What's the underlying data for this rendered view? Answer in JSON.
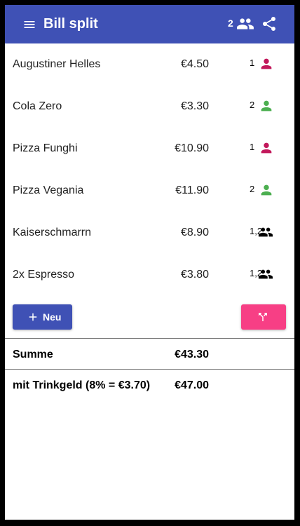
{
  "appbar": {
    "title": "Bill split",
    "people_count": "2",
    "menu_icon": "menu-icon",
    "people_icon": "people-icon",
    "share_icon": "share-icon"
  },
  "items": [
    {
      "name": "Augustiner Helles",
      "price": "€4.50",
      "assigned": "1",
      "icon": "person-icon",
      "icon_color": "#c2185b"
    },
    {
      "name": "Cola Zero",
      "price": "€3.30",
      "assigned": "2",
      "icon": "person-icon",
      "icon_color": "#4caf50"
    },
    {
      "name": "Pizza Funghi",
      "price": "€10.90",
      "assigned": "1",
      "icon": "person-icon",
      "icon_color": "#c2185b"
    },
    {
      "name": "Pizza Vegania",
      "price": "€11.90",
      "assigned": "2",
      "icon": "person-icon",
      "icon_color": "#4caf50"
    },
    {
      "name": "Kaiserschmarrn",
      "price": "€8.90",
      "assigned": "1,2",
      "icon": "people-icon",
      "icon_color": "#000000"
    },
    {
      "name": "2x Espresso",
      "price": "€3.80",
      "assigned": "1,2",
      "icon": "people-icon",
      "icon_color": "#000000"
    }
  ],
  "actions": {
    "new_label": "Neu",
    "new_icon": "plus-icon",
    "split_icon": "call-split-icon"
  },
  "totals": {
    "sum_label": "Summe",
    "sum_value": "€43.30",
    "tip_label": "mit Trinkgeld (8% = €3.70)",
    "tip_value": "€47.00"
  },
  "colors": {
    "primary": "#3f51b5",
    "accent": "#f73f85",
    "person1": "#c2185b",
    "person2": "#4caf50"
  }
}
